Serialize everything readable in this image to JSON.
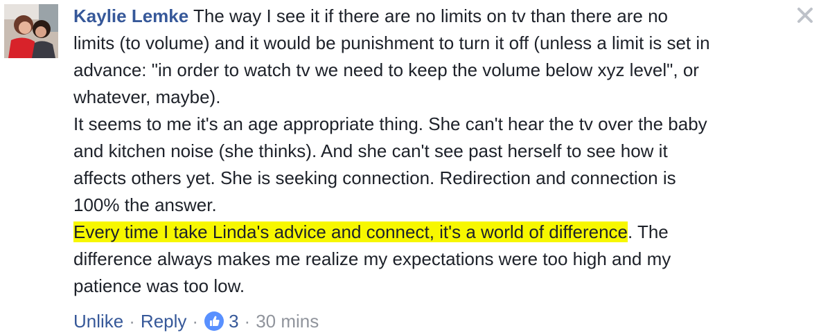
{
  "comment": {
    "author": "Kaylie Lemke",
    "lines": [
      "The way I see it if there are no limits on tv than there are no",
      "limits (to volume) and it would be punishment to turn it off (unless a limit is set in",
      "advance: \"in order to watch tv we need to keep the volume below xyz level\", or",
      "whatever, maybe).",
      "It seems to me it's an age appropriate thing. She can't hear the tv over the baby",
      "and kitchen noise (she thinks). And she can't see past herself to see how it",
      "affects others yet. She is seeking connection. Redirection and connection is",
      "100% the answer."
    ],
    "highlighted_text": "Every time I take Linda's advice and connect, it's a world of difference",
    "after_highlight": ". The",
    "final_lines": [
      "difference always makes me realize my expectations were too high and my",
      "patience was too low."
    ]
  },
  "actions": {
    "unlike_label": "Unlike",
    "reply_label": "Reply",
    "separator": "·",
    "like_count": "3",
    "timestamp": "30 mins"
  },
  "icons": {
    "close": "close-icon",
    "like": "thumbs-up-icon"
  },
  "colors": {
    "author": "#365899",
    "highlight": "#f7f700",
    "meta": "#90949c",
    "like_badge": "#5890ff"
  }
}
